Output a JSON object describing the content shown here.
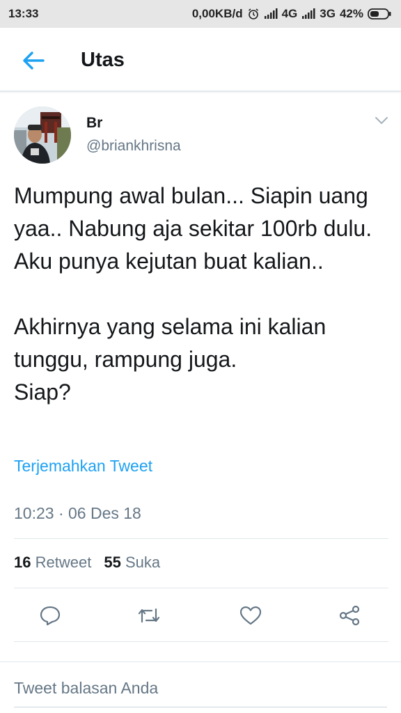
{
  "status_bar": {
    "time": "13:33",
    "data_speed": "0,00KB/d",
    "network_1": "4G",
    "network_2": "3G",
    "battery": "42%"
  },
  "app_bar": {
    "title": "Utas",
    "back_icon": "arrow-left-icon"
  },
  "tweet": {
    "author_name": "Br",
    "author_handle": "@briankhrisna",
    "text": "Mumpung awal bulan... Siapin uang yaa.. Nabung aja sekitar 100rb dulu.\nAku punya kejutan buat kalian..\n\nAkhirnya yang selama ini kalian tunggu, rampung juga.\nSiap?",
    "translate_label": "Terjemahkan Tweet",
    "timestamp": "10:23 · 06 Des 18",
    "retweet_count": "16",
    "retweet_label": "Retweet",
    "like_count": "55",
    "like_label": "Suka"
  },
  "actions": {
    "reply_icon": "reply-icon",
    "retweet_icon": "retweet-icon",
    "like_icon": "heart-icon",
    "share_icon": "share-icon"
  },
  "reply_bar": {
    "placeholder": "Tweet balasan Anda"
  },
  "colors": {
    "accent": "#1da1f2",
    "text_primary": "#14171a",
    "text_secondary": "#657786",
    "divider": "#e1e8ed",
    "status_bar_bg": "#e6e6e6"
  }
}
